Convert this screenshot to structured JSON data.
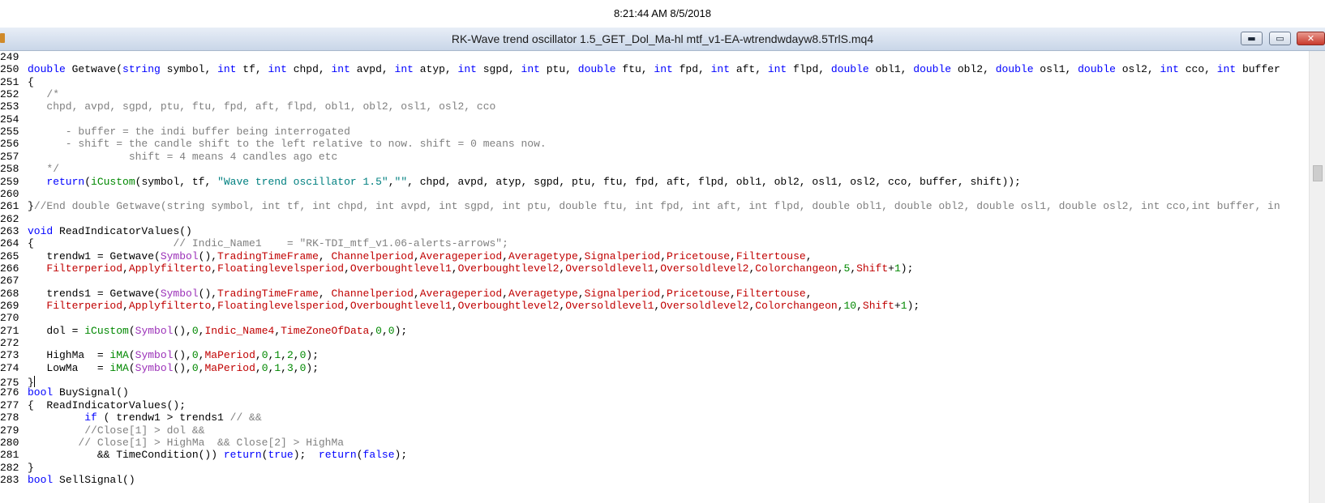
{
  "clock": "8:21:44 AM 8/5/2018",
  "window": {
    "title": "RK-Wave trend oscillator 1.5_GET_Dol_Ma-hl mtf_v1-EA-wtrendwdayw8.5TrlS.mq4",
    "min_glyph": "▬",
    "max_glyph": "▭",
    "close_glyph": "✕"
  },
  "colors": {
    "keyword": "#0000ff",
    "function": "#008800",
    "comment": "#808080",
    "string": "#008080",
    "variable": "#c00000",
    "predefined": "#9b30b8"
  },
  "lines": [
    {
      "n": "249",
      "tokens": []
    },
    {
      "n": "250",
      "tokens": [
        [
          "kw",
          "double"
        ],
        [
          "t",
          " Getwave("
        ],
        [
          "kw",
          "string"
        ],
        [
          "t",
          " symbol, "
        ],
        [
          "kw",
          "int"
        ],
        [
          "t",
          " tf, "
        ],
        [
          "kw",
          "int"
        ],
        [
          "t",
          " chpd, "
        ],
        [
          "kw",
          "int"
        ],
        [
          "t",
          " avpd, "
        ],
        [
          "kw",
          "int"
        ],
        [
          "t",
          " atyp, "
        ],
        [
          "kw",
          "int"
        ],
        [
          "t",
          " sgpd, "
        ],
        [
          "kw",
          "int"
        ],
        [
          "t",
          " ptu, "
        ],
        [
          "kw",
          "double"
        ],
        [
          "t",
          " ftu, "
        ],
        [
          "kw",
          "int"
        ],
        [
          "t",
          " fpd, "
        ],
        [
          "kw",
          "int"
        ],
        [
          "t",
          " aft, "
        ],
        [
          "kw",
          "int"
        ],
        [
          "t",
          " flpd, "
        ],
        [
          "kw",
          "double"
        ],
        [
          "t",
          " obl1, "
        ],
        [
          "kw",
          "double"
        ],
        [
          "t",
          " obl2, "
        ],
        [
          "kw",
          "double"
        ],
        [
          "t",
          " osl1, "
        ],
        [
          "kw",
          "double"
        ],
        [
          "t",
          " osl2, "
        ],
        [
          "kw",
          "int"
        ],
        [
          "t",
          " cco, "
        ],
        [
          "kw",
          "int"
        ],
        [
          "t",
          " buffer"
        ]
      ]
    },
    {
      "n": "251",
      "tokens": [
        [
          "t",
          "{"
        ]
      ]
    },
    {
      "n": "252",
      "tokens": [
        [
          "cm",
          "   /*"
        ]
      ]
    },
    {
      "n": "253",
      "tokens": [
        [
          "cm",
          "   chpd, avpd, sgpd, ptu, ftu, fpd, aft, flpd, obl1, obl2, osl1, osl2, cco"
        ]
      ]
    },
    {
      "n": "254",
      "tokens": []
    },
    {
      "n": "255",
      "tokens": [
        [
          "cm",
          "      - buffer = the indi buffer being interrogated"
        ]
      ]
    },
    {
      "n": "256",
      "tokens": [
        [
          "cm",
          "      - shift = the candle shift to the left relative to now. shift = 0 means now."
        ]
      ]
    },
    {
      "n": "257",
      "tokens": [
        [
          "cm",
          "                shift = 4 means 4 candles ago etc"
        ]
      ]
    },
    {
      "n": "258",
      "tokens": [
        [
          "cm",
          "   */"
        ]
      ]
    },
    {
      "n": "259",
      "tokens": [
        [
          "t",
          "   "
        ],
        [
          "kw",
          "return"
        ],
        [
          "t",
          "("
        ],
        [
          "fn",
          "iCustom"
        ],
        [
          "t",
          "(symbol, tf, "
        ],
        [
          "str",
          "\"Wave trend oscillator 1.5\""
        ],
        [
          "t",
          ","
        ],
        [
          "str",
          "\"\""
        ],
        [
          "t",
          ", chpd, avpd, atyp, sgpd, ptu, ftu, fpd, aft, flpd, obl1, obl2, osl1, osl2, cco, buffer, shift));"
        ]
      ]
    },
    {
      "n": "260",
      "tokens": []
    },
    {
      "n": "261",
      "tokens": [
        [
          "t",
          "}"
        ],
        [
          "cm",
          "//End double Getwave(string symbol, int tf, int chpd, int avpd, int sgpd, int ptu, double ftu, int fpd, int aft, int flpd, double obl1, double obl2, double osl1, double osl2, int cco,int buffer, in"
        ]
      ]
    },
    {
      "n": "262",
      "tokens": []
    },
    {
      "n": "263",
      "tokens": [
        [
          "kw",
          "void"
        ],
        [
          "t",
          " ReadIndicatorValues()"
        ]
      ]
    },
    {
      "n": "264",
      "tokens": [
        [
          "t",
          "{                      "
        ],
        [
          "cm",
          "// Indic_Name1    = \"RK-TDI_mtf_v1.06-alerts-arrows\";"
        ]
      ]
    },
    {
      "n": "265",
      "tokens": [
        [
          "t",
          "   trendw1 = Getwave("
        ],
        [
          "pu",
          "Symbol"
        ],
        [
          "t",
          "(),"
        ],
        [
          "var",
          "TradingTimeFrame"
        ],
        [
          "t",
          ", "
        ],
        [
          "var",
          "Channelperiod"
        ],
        [
          "t",
          ","
        ],
        [
          "var",
          "Averageperiod"
        ],
        [
          "t",
          ","
        ],
        [
          "var",
          "Averagetype"
        ],
        [
          "t",
          ","
        ],
        [
          "var",
          "Signalperiod"
        ],
        [
          "t",
          ","
        ],
        [
          "var",
          "Pricetouse"
        ],
        [
          "t",
          ","
        ],
        [
          "var",
          "Filtertouse"
        ],
        [
          "t",
          ","
        ]
      ]
    },
    {
      "n": "266",
      "tokens": [
        [
          "t",
          "   "
        ],
        [
          "var",
          "Filterperiod"
        ],
        [
          "t",
          ","
        ],
        [
          "var",
          "Applyfilterto"
        ],
        [
          "t",
          ","
        ],
        [
          "var",
          "Floatinglevelsperiod"
        ],
        [
          "t",
          ","
        ],
        [
          "var",
          "Overboughtlevel1"
        ],
        [
          "t",
          ","
        ],
        [
          "var",
          "Overboughtlevel2"
        ],
        [
          "t",
          ","
        ],
        [
          "var",
          "Oversoldlevel1"
        ],
        [
          "t",
          ","
        ],
        [
          "var",
          "Oversoldlevel2"
        ],
        [
          "t",
          ","
        ],
        [
          "var",
          "Colorchangeon"
        ],
        [
          "t",
          ","
        ],
        [
          "num",
          "5"
        ],
        [
          "t",
          ","
        ],
        [
          "var",
          "Shift"
        ],
        [
          "t",
          "+"
        ],
        [
          "num",
          "1"
        ],
        [
          "t",
          ");"
        ]
      ]
    },
    {
      "n": "267",
      "tokens": []
    },
    {
      "n": "268",
      "tokens": [
        [
          "t",
          "   trends1 = Getwave("
        ],
        [
          "pu",
          "Symbol"
        ],
        [
          "t",
          "(),"
        ],
        [
          "var",
          "TradingTimeFrame"
        ],
        [
          "t",
          ", "
        ],
        [
          "var",
          "Channelperiod"
        ],
        [
          "t",
          ","
        ],
        [
          "var",
          "Averageperiod"
        ],
        [
          "t",
          ","
        ],
        [
          "var",
          "Averagetype"
        ],
        [
          "t",
          ","
        ],
        [
          "var",
          "Signalperiod"
        ],
        [
          "t",
          ","
        ],
        [
          "var",
          "Pricetouse"
        ],
        [
          "t",
          ","
        ],
        [
          "var",
          "Filtertouse"
        ],
        [
          "t",
          ","
        ]
      ]
    },
    {
      "n": "269",
      "tokens": [
        [
          "t",
          "   "
        ],
        [
          "var",
          "Filterperiod"
        ],
        [
          "t",
          ","
        ],
        [
          "var",
          "Applyfilterto"
        ],
        [
          "t",
          ","
        ],
        [
          "var",
          "Floatinglevelsperiod"
        ],
        [
          "t",
          ","
        ],
        [
          "var",
          "Overboughtlevel1"
        ],
        [
          "t",
          ","
        ],
        [
          "var",
          "Overboughtlevel2"
        ],
        [
          "t",
          ","
        ],
        [
          "var",
          "Oversoldlevel1"
        ],
        [
          "t",
          ","
        ],
        [
          "var",
          "Oversoldlevel2"
        ],
        [
          "t",
          ","
        ],
        [
          "var",
          "Colorchangeon"
        ],
        [
          "t",
          ","
        ],
        [
          "num",
          "10"
        ],
        [
          "t",
          ","
        ],
        [
          "var",
          "Shift"
        ],
        [
          "t",
          "+"
        ],
        [
          "num",
          "1"
        ],
        [
          "t",
          ");"
        ]
      ]
    },
    {
      "n": "270",
      "tokens": []
    },
    {
      "n": "271",
      "tokens": [
        [
          "t",
          "   dol = "
        ],
        [
          "fn",
          "iCustom"
        ],
        [
          "t",
          "("
        ],
        [
          "pu",
          "Symbol"
        ],
        [
          "t",
          "(),"
        ],
        [
          "num",
          "0"
        ],
        [
          "t",
          ","
        ],
        [
          "var",
          "Indic_Name4"
        ],
        [
          "t",
          ","
        ],
        [
          "var",
          "TimeZoneOfData"
        ],
        [
          "t",
          ","
        ],
        [
          "num",
          "0"
        ],
        [
          "t",
          ","
        ],
        [
          "num",
          "0"
        ],
        [
          "t",
          ");"
        ]
      ]
    },
    {
      "n": "272",
      "tokens": []
    },
    {
      "n": "273",
      "tokens": [
        [
          "t",
          "   HighMa  = "
        ],
        [
          "fn",
          "iMA"
        ],
        [
          "t",
          "("
        ],
        [
          "pu",
          "Symbol"
        ],
        [
          "t",
          "(),"
        ],
        [
          "num",
          "0"
        ],
        [
          "t",
          ","
        ],
        [
          "var",
          "MaPeriod"
        ],
        [
          "t",
          ","
        ],
        [
          "num",
          "0"
        ],
        [
          "t",
          ","
        ],
        [
          "num",
          "1"
        ],
        [
          "t",
          ","
        ],
        [
          "num",
          "2"
        ],
        [
          "t",
          ","
        ],
        [
          "num",
          "0"
        ],
        [
          "t",
          ");"
        ]
      ]
    },
    {
      "n": "274",
      "tokens": [
        [
          "t",
          "   LowMa   = "
        ],
        [
          "fn",
          "iMA"
        ],
        [
          "t",
          "("
        ],
        [
          "pu",
          "Symbol"
        ],
        [
          "t",
          "(),"
        ],
        [
          "num",
          "0"
        ],
        [
          "t",
          ","
        ],
        [
          "var",
          "MaPeriod"
        ],
        [
          "t",
          ","
        ],
        [
          "num",
          "0"
        ],
        [
          "t",
          ","
        ],
        [
          "num",
          "1"
        ],
        [
          "t",
          ","
        ],
        [
          "num",
          "3"
        ],
        [
          "t",
          ","
        ],
        [
          "num",
          "0"
        ],
        [
          "t",
          ");"
        ]
      ]
    },
    {
      "n": "275",
      "tokens": [
        [
          "t",
          "}"
        ]
      ]
    },
    {
      "n": "276",
      "tokens": [
        [
          "kw",
          "bool"
        ],
        [
          "t",
          " BuySignal()"
        ]
      ]
    },
    {
      "n": "277",
      "tokens": [
        [
          "t",
          "{  ReadIndicatorValues();"
        ]
      ]
    },
    {
      "n": "278",
      "tokens": [
        [
          "t",
          "         "
        ],
        [
          "kw",
          "if"
        ],
        [
          "t",
          " ( trendw1 > trends1 "
        ],
        [
          "cm",
          "// &&"
        ]
      ]
    },
    {
      "n": "279",
      "tokens": [
        [
          "cm",
          "         //Close[1] > dol &&"
        ]
      ]
    },
    {
      "n": "280",
      "tokens": [
        [
          "cm",
          "        // Close[1] > HighMa  && Close[2] > HighMa"
        ]
      ]
    },
    {
      "n": "281",
      "tokens": [
        [
          "t",
          "           && TimeCondition()) "
        ],
        [
          "kw",
          "return"
        ],
        [
          "t",
          "("
        ],
        [
          "kw",
          "true"
        ],
        [
          "t",
          ");  "
        ],
        [
          "kw",
          "return"
        ],
        [
          "t",
          "("
        ],
        [
          "kw",
          "false"
        ],
        [
          "t",
          ");"
        ]
      ]
    },
    {
      "n": "282",
      "tokens": [
        [
          "t",
          "}"
        ]
      ]
    },
    {
      "n": "283",
      "tokens": [
        [
          "kw",
          "bool"
        ],
        [
          "t",
          " SellSignal()"
        ]
      ]
    }
  ]
}
